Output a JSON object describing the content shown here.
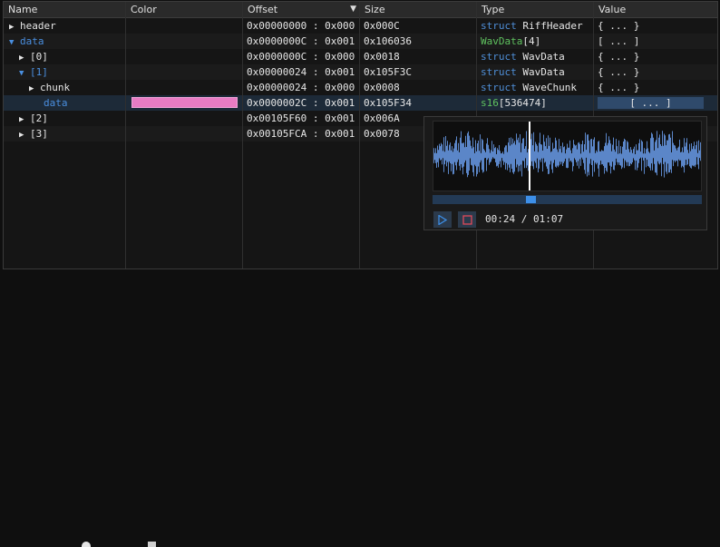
{
  "table": {
    "columns": [
      {
        "label": "Name"
      },
      {
        "label": "Color"
      },
      {
        "label": "Offset",
        "sorted": true
      },
      {
        "label": "Size"
      },
      {
        "label": "Type"
      },
      {
        "label": "Value"
      }
    ],
    "rows": [
      {
        "name": "header",
        "expand": "closed",
        "indent": 0,
        "name_color": "default",
        "offset": "0x00000000 : 0x000",
        "size": "0x000C",
        "type_kw": "struct",
        "type_name": "RiffHeader",
        "type_suffix": "",
        "value": "{ ... }"
      },
      {
        "name": "data",
        "expand": "open",
        "indent": 0,
        "name_color": "blue",
        "offset": "0x0000000C : 0x001",
        "size": "0x106036",
        "type_kw": "",
        "type_name": "WavData",
        "type_suffix": "[4]",
        "value": "[ ... ]"
      },
      {
        "name": "[0]",
        "expand": "closed",
        "indent": 1,
        "name_color": "default",
        "offset": "0x0000000C : 0x000",
        "size": "0x0018",
        "type_kw": "struct",
        "type_name": "WavData",
        "type_suffix": "",
        "value": "{ ... }"
      },
      {
        "name": "[1]",
        "expand": "open",
        "indent": 1,
        "name_color": "blue",
        "offset": "0x00000024 : 0x001",
        "size": "0x105F3C",
        "type_kw": "struct",
        "type_name": "WavData",
        "type_suffix": "",
        "value": "{ ... }"
      },
      {
        "name": "chunk",
        "expand": "closed",
        "indent": 2,
        "name_color": "default",
        "offset": "0x00000024 : 0x000",
        "size": "0x0008",
        "type_kw": "struct",
        "type_name": "WaveChunk",
        "type_suffix": "",
        "value": "{ ... }"
      },
      {
        "name": "data",
        "expand": "none",
        "indent": 2,
        "name_color": "blue",
        "highlight": true,
        "color_swatch": "#e87cc4",
        "offset": "0x0000002C : 0x001",
        "size": "0x105F34",
        "type_kw": "s16",
        "type_name": "",
        "type_suffix": "[536474]",
        "value": "[ ... ]",
        "value_button": true
      },
      {
        "name": "[2]",
        "expand": "closed",
        "indent": 1,
        "name_color": "default",
        "offset": "0x00105F60 : 0x001",
        "size": "0x006A",
        "type_kw": "",
        "type_name": "",
        "type_suffix": "",
        "value": ""
      },
      {
        "name": "[3]",
        "expand": "closed",
        "indent": 1,
        "name_color": "default",
        "offset": "0x00105FCA : 0x001",
        "size": "0x0078",
        "type_kw": "",
        "type_name": "",
        "type_suffix": "",
        "value": ""
      }
    ]
  },
  "audio_popup": {
    "time_current": "00:24",
    "time_total": "01:07",
    "time_display": "00:24 / 01:07",
    "progress_fraction": 0.36,
    "play_icon": "play-icon",
    "stop_icon": "stop-icon",
    "accent_color": "#3d8fe8",
    "wave_color": "#5b86c8"
  },
  "colors": {
    "blue_name": "#4a8fe0",
    "keyword": "#4f8fd8",
    "template_type": "#5fc25f",
    "swatch": "#e87cc4"
  }
}
